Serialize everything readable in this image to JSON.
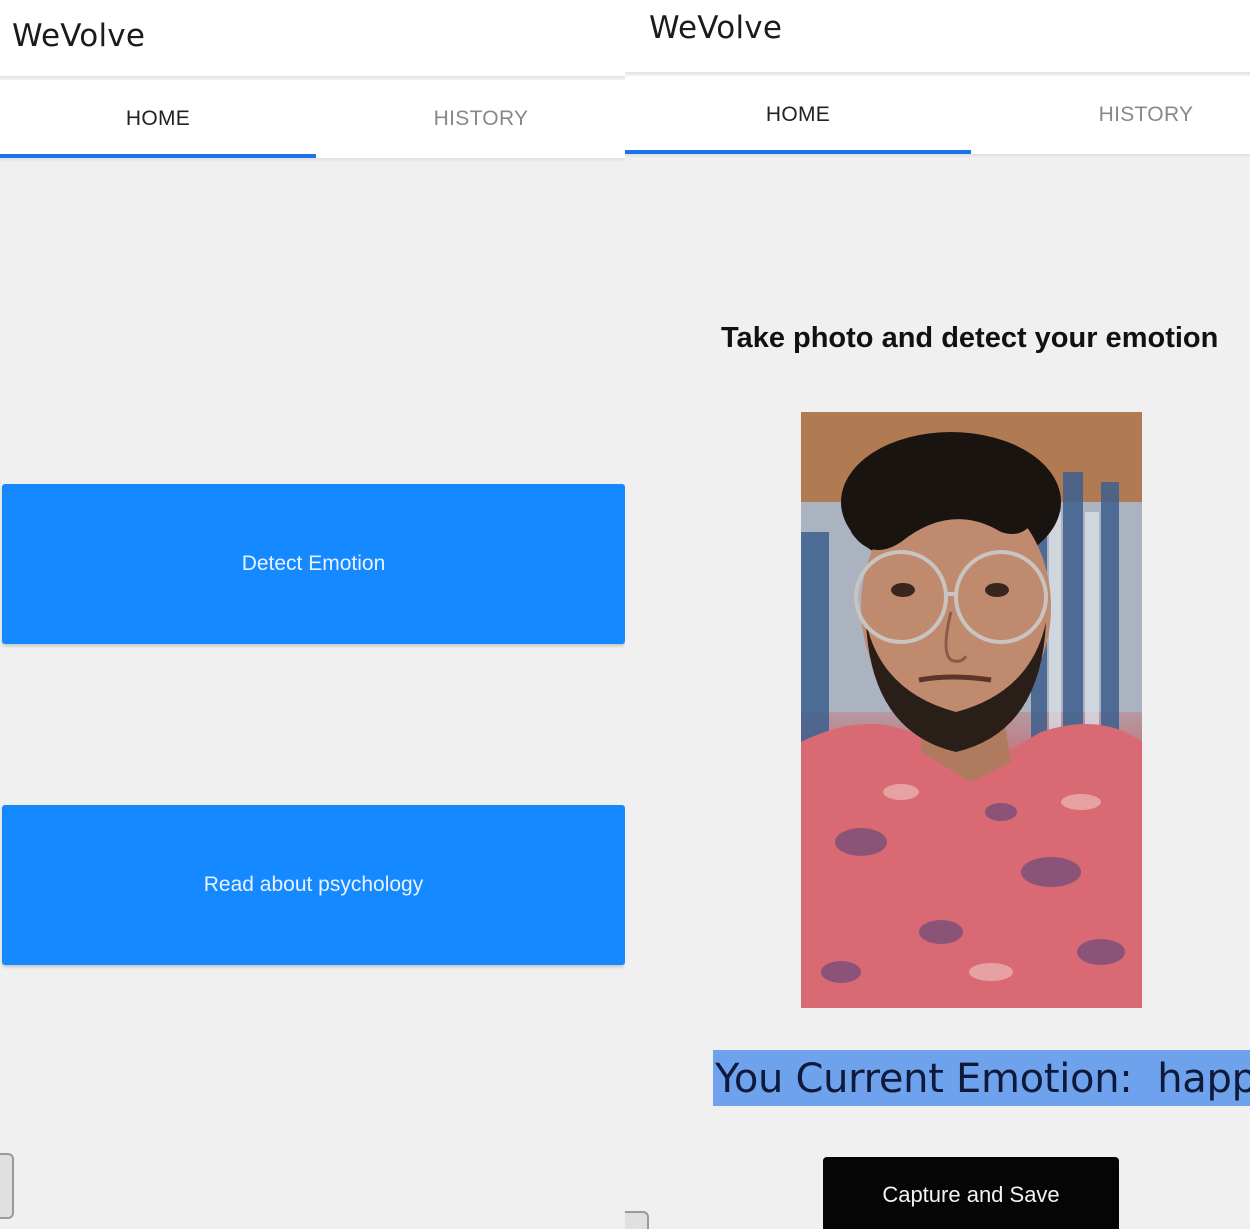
{
  "left_screen": {
    "app_title": "WeVolve",
    "tabs": [
      {
        "label": "HOME",
        "active": true
      },
      {
        "label": "HISTORY",
        "active": false
      }
    ],
    "buttons": {
      "detect_emotion": "Detect Emotion",
      "read_psychology": "Read about psychology"
    }
  },
  "right_screen": {
    "app_title": "WeVolve",
    "tabs": [
      {
        "label": "HOME",
        "active": true
      },
      {
        "label": "HISTORY",
        "active": false
      }
    ],
    "heading": "Take photo and detect your emotion",
    "emotion_text": "You Current Emotion:  happy",
    "capture_button": "Capture and Save"
  },
  "colors": {
    "accent": "#1a73e8",
    "button_blue": "#1589ff",
    "selection_highlight": "#6ea2ec",
    "capture_button": "#050505"
  }
}
